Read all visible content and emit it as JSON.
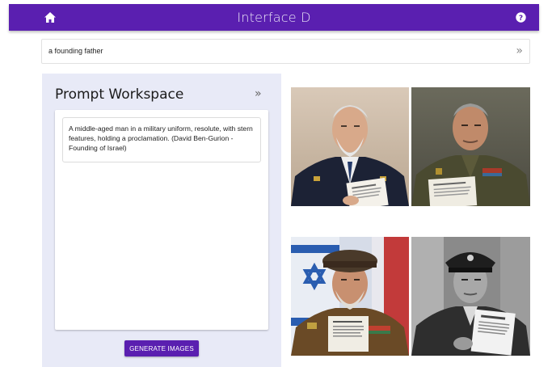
{
  "app": {
    "title": "Interface D"
  },
  "icons": {
    "home": "home-icon",
    "help": "help-icon",
    "expand": "double-chevron-right-icon"
  },
  "colors": {
    "primary": "#5a1fb0",
    "workspace_bg": "#e8eaf7"
  },
  "search": {
    "value": "a founding father",
    "expand_glyph": "»"
  },
  "workspace": {
    "title": "Prompt Workspace",
    "expand_glyph": "»",
    "prompt_text": "A middle-aged man in a military uniform, resolute, with stern features, holding a proclamation. (David Ben-Gurion - Founding of Israel)",
    "generate_label": "GENERATE IMAGES"
  },
  "images": [
    {
      "subject": "elderly man with white beard in navy uniform holding paper"
    },
    {
      "subject": "stern man in olive military uniform holding document"
    },
    {
      "subject": "bearded man in beret with Israeli flag holding proclamation"
    },
    {
      "subject": "black and white portrait of officer in peaked cap holding paper"
    }
  ]
}
